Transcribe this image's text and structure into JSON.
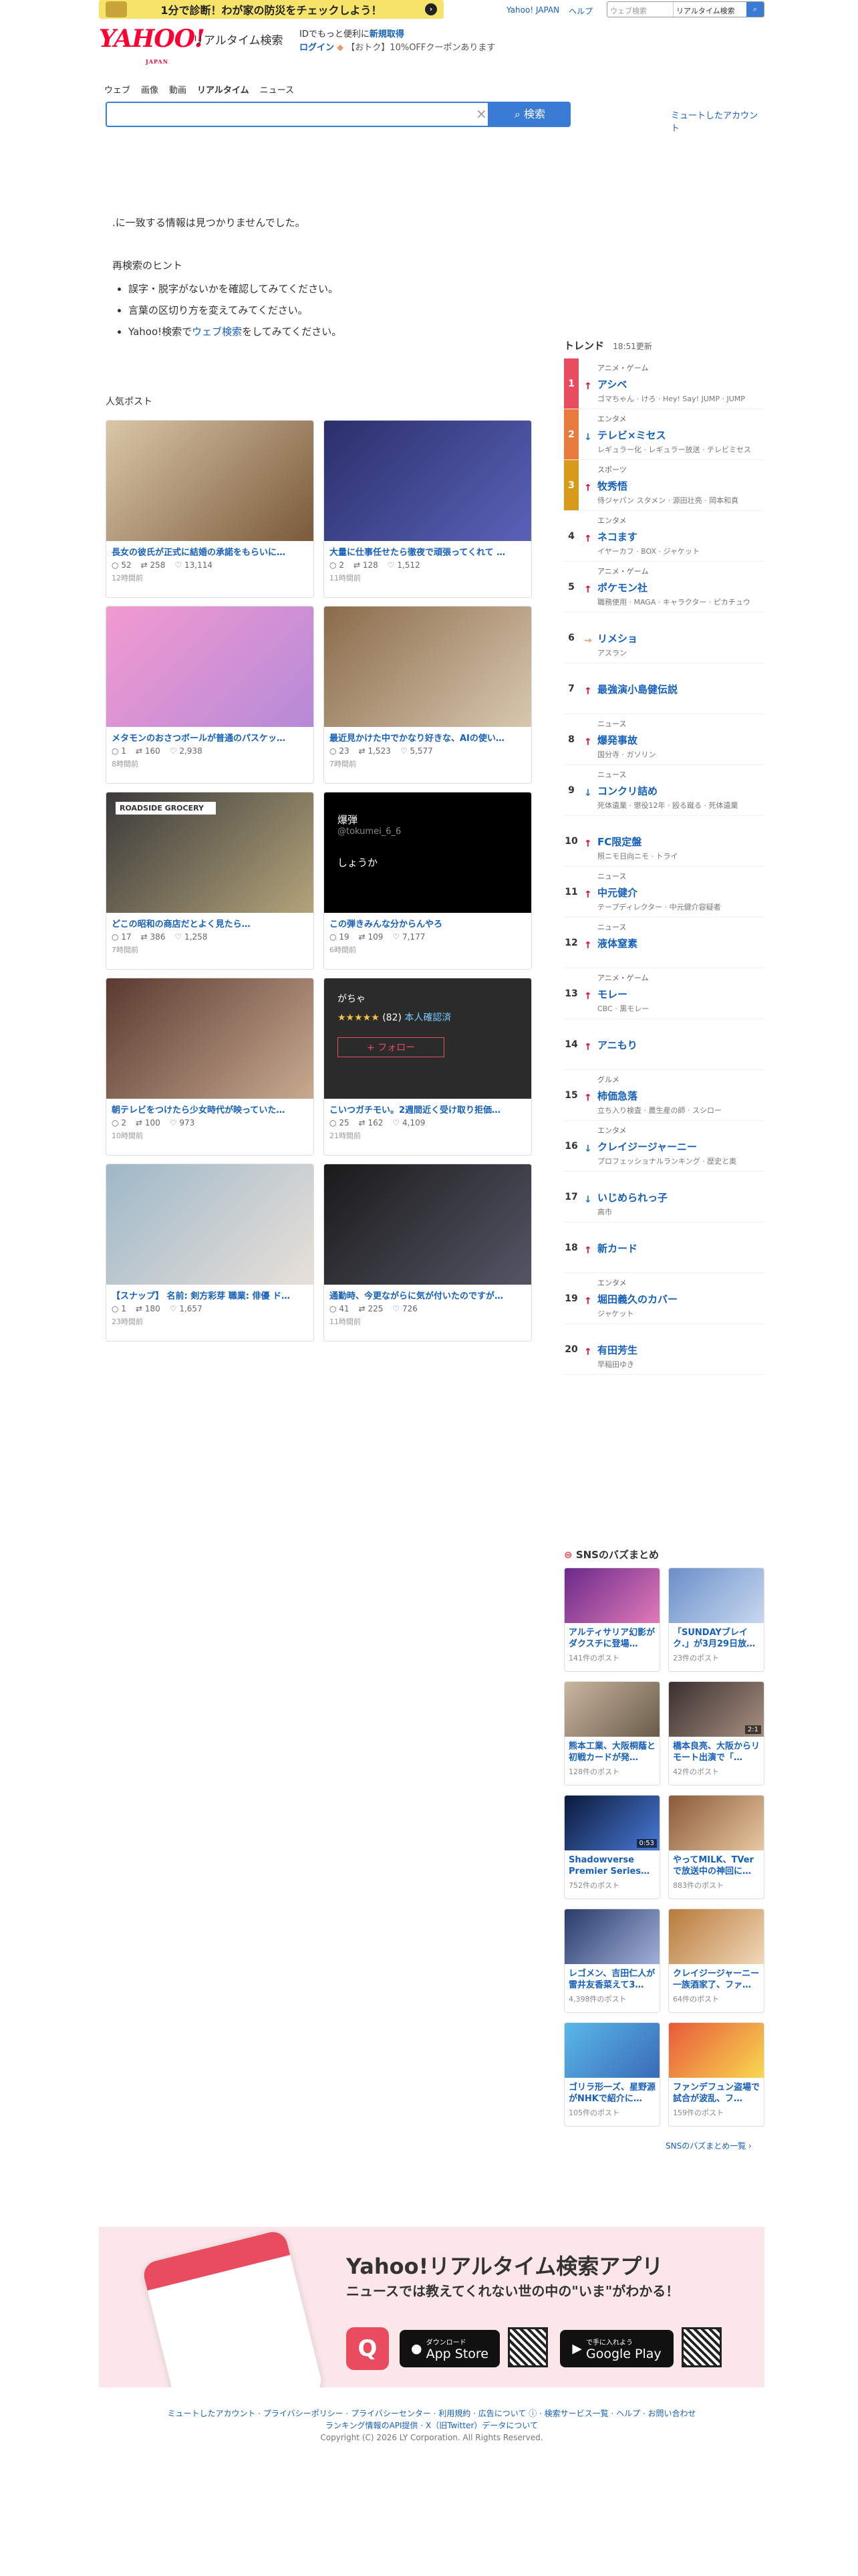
{
  "promo": {
    "text": "1分で診断！わが家の防災をチェックしよう！"
  },
  "toplinks": [
    "Yahoo! JAPAN",
    "ヘルプ"
  ],
  "topsearch": {
    "placeholder": "ウェブ検索",
    "select": "リアルタイム検索"
  },
  "header": {
    "logo": "YAHOO!",
    "logo_sub": "JAPAN",
    "service": "リアルタイム検索",
    "id_note": "IDでもっと便利に",
    "register": "新規取得",
    "login": "ログイン",
    "coupon": "【おトク】10%OFFクーポンあります"
  },
  "nav": [
    "ウェブ",
    "画像",
    "動画",
    "リアルタイム",
    "ニュース"
  ],
  "search": {
    "value": "",
    "button": "検索",
    "clear": "×"
  },
  "muted_link": "ミュートしたアカウント",
  "noresult": ".に一致する情報は見つかりませんでした。",
  "hints": {
    "title": "再検索のヒント",
    "items": [
      "誤字・脱字がないかを確認してみてください。",
      "言葉の区切り方を変えてみてください。"
    ],
    "last_prefix": "Yahoo!検索で",
    "last_link": "ウェブ検索",
    "last_suffix": "をしてみてください。"
  },
  "popular": {
    "title": "人気ポスト",
    "posts": [
      {
        "caption": "長女の彼氏が正式に結婚の承諾をもらいに…",
        "replies": "52",
        "reposts": "258",
        "likes": "13,114",
        "time": "12時間前"
      },
      {
        "caption": "大量に仕事任せたら徹夜で頑張ってくれて …",
        "replies": "2",
        "reposts": "128",
        "likes": "1,512",
        "time": "11時間前"
      },
      {
        "caption": "メタモンのおさつボールが普通のパスケッ…",
        "replies": "1",
        "reposts": "160",
        "likes": "2,938",
        "time": "8時間前"
      },
      {
        "caption": "最近見かけた中でかなり好きな、AIの使い…",
        "replies": "23",
        "reposts": "1,523",
        "likes": "5,577",
        "time": "7時間前"
      },
      {
        "caption": "どこの昭和の商店だとよく見たら…",
        "replies": "17",
        "reposts": "386",
        "likes": "1,258",
        "time": "7時間前"
      },
      {
        "caption": "この弾きみんな分からんやろ",
        "replies": "19",
        "reposts": "109",
        "likes": "7,177",
        "time": "6時間前"
      },
      {
        "caption": "朝テレビをつけたら少女時代が映っていた…",
        "replies": "2",
        "reposts": "100",
        "likes": "973",
        "time": "10時間前"
      },
      {
        "caption": "こいつガチモい。2週間近く受け取り拒価…",
        "replies": "25",
        "reposts": "162",
        "likes": "4,109",
        "time": "21時間前"
      },
      {
        "caption": "【スナップ】 名前: 剣方彩芽 職業: 俳優 ド…",
        "replies": "1",
        "reposts": "180",
        "likes": "1,657",
        "time": "23時間前"
      },
      {
        "caption": "通勤時、今更ながらに気が付いたのですが…",
        "replies": "41",
        "reposts": "225",
        "likes": "726",
        "time": "11時間前"
      }
    ],
    "img_texts": {
      "shop": "ROADSIDE GROCERY",
      "tweet_name": "爆弾",
      "tweet_handle": "@tokumei_6_6",
      "tweet_body": "しょうか",
      "review_name": "がちゃ",
      "review_count": "(82)",
      "review_badge": "本人確認済",
      "review_follow": "+ フォロー"
    }
  },
  "trend": {
    "title": "トレンド",
    "updated": "18:51更新",
    "items": [
      {
        "rank": "1",
        "dir": "up",
        "cat": "アニメ・ゲーム",
        "name": "アシベ",
        "sub": "ゴマちゃん · けろ · Hey! Say! JUMP · JUMP"
      },
      {
        "rank": "2",
        "dir": "down",
        "cat": "エンタメ",
        "name": "テレビ×ミセス",
        "sub": "レギュラー化 · レギュラー放送 · テレビミセス"
      },
      {
        "rank": "3",
        "dir": "up",
        "cat": "スポーツ",
        "name": "牧秀悟",
        "sub": "侍ジャパン スタメン · 源田壮亮 · 岡本和真"
      },
      {
        "rank": "4",
        "dir": "up",
        "cat": "エンタメ",
        "name": "ネコます",
        "sub": "イヤーカフ · BOX · ジャケット"
      },
      {
        "rank": "5",
        "dir": "up",
        "cat": "アニメ・ゲーム",
        "name": "ポケモン社",
        "sub": "職務使用 · MAGA · キャラクター · ピカチュウ"
      },
      {
        "rank": "6",
        "dir": "flat",
        "cat": "",
        "name": "リメショ",
        "sub": "アスラン"
      },
      {
        "rank": "7",
        "dir": "up",
        "cat": "",
        "name": "最強演小島健伝説",
        "sub": ""
      },
      {
        "rank": "8",
        "dir": "up",
        "cat": "ニュース",
        "name": "爆発事故",
        "sub": "国分寺 · ガソリン"
      },
      {
        "rank": "9",
        "dir": "down",
        "cat": "ニュース",
        "name": "コンクリ詰め",
        "sub": "死体遺棄 · 懲役12年 · 殴る蹴る · 死体遺棄"
      },
      {
        "rank": "10",
        "dir": "up",
        "cat": "",
        "name": "FC限定盤",
        "sub": "照ニモ日向ニモ · トライ"
      },
      {
        "rank": "11",
        "dir": "up",
        "cat": "ニュース",
        "name": "中元健介",
        "sub": "テープディレクター · 中元健介容疑者"
      },
      {
        "rank": "12",
        "dir": "up",
        "cat": "ニュース",
        "name": "液体窒素",
        "sub": ""
      },
      {
        "rank": "13",
        "dir": "up",
        "cat": "アニメ・ゲーム",
        "name": "モレー",
        "sub": "CBC · 黒モレー"
      },
      {
        "rank": "14",
        "dir": "up",
        "cat": "",
        "name": "アニもり",
        "sub": ""
      },
      {
        "rank": "15",
        "dir": "up",
        "cat": "グルメ",
        "name": "柿価急落",
        "sub": "立ち入り検査 · 農生産の師 · スシロー"
      },
      {
        "rank": "16",
        "dir": "down",
        "cat": "エンタメ",
        "name": "クレイジージャーニー",
        "sub": "プロフェッショナルランキング · 歴史と奥"
      },
      {
        "rank": "17",
        "dir": "down",
        "cat": "",
        "name": "いじめられっ子",
        "sub": "高市"
      },
      {
        "rank": "18",
        "dir": "up",
        "cat": "",
        "name": "新カード",
        "sub": ""
      },
      {
        "rank": "19",
        "dir": "up",
        "cat": "エンタメ",
        "name": "堀田義久のカバー",
        "sub": "ジャケット"
      },
      {
        "rank": "20",
        "dir": "up",
        "cat": "",
        "name": "有田芳生",
        "sub": "早稲田ゆき"
      }
    ]
  },
  "sns": {
    "title": "SNSのバズまとめ",
    "more": "SNSのバズまとめ一覧 ›",
    "items": [
      {
        "caption": "アルティサリア幻影がダクスチに登場…",
        "count": "141件のポスト"
      },
      {
        "caption": "「SUNDAYブレイク.」が3月29日放…",
        "count": "23件のポスト"
      },
      {
        "caption": "熊本工業、大阪桐蔭と初戦カードが発…",
        "count": "128件のポスト"
      },
      {
        "caption": "橋本良亮、大阪からリモート出演で「…",
        "count": "42件のポスト"
      },
      {
        "caption": "Shadowverse Premier Series…",
        "count": "752件のポスト"
      },
      {
        "caption": "やってMILK、TVerで放送中の神回に…",
        "count": "883件のポスト"
      },
      {
        "caption": "レゴメン、吉田仁人が雷井友香菜えて3…",
        "count": "4,398件のポスト"
      },
      {
        "caption": "クレイジージャーニー一族酒家了、ファ…",
        "count": "64件のポスト"
      },
      {
        "caption": "ゴリラ形一ズ、星野源がNHKで紹介に…",
        "count": "105件のポスト"
      },
      {
        "caption": "ファンデフュン盗場で試合が波乱、フ…",
        "count": "159件のポスト"
      }
    ],
    "durations": {
      "v3": "2:1",
      "v5": "0:53"
    }
  },
  "app": {
    "title": "Yahoo!リアルタイム検索アプリ",
    "sub": "ニュースでは教えてくれない世の中の\"いま\"がわかる！",
    "appstore_small": "ダウンロード",
    "appstore": "App Store",
    "googleplay_small": "で手に入れよう",
    "googleplay": "Google Play"
  },
  "footer": {
    "line1": "ミュートしたアカウント · プライバシーポリシー · プライバシーセンター · 利用規約 · 広告について ⓘ · 検索サービス一覧 · ヘルプ · お問い合わせ",
    "line2": "ランキング情報のAPI提供 · X（旧Twitter）データについて",
    "copyright": "Copyright (C) 2026 LY Corporation. All Rights Reserved."
  }
}
